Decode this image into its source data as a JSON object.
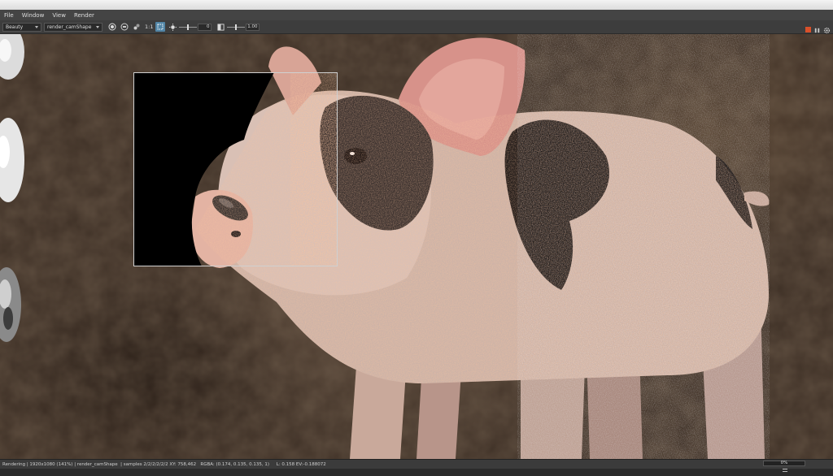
{
  "window": {
    "menu": [
      "File",
      "Window",
      "View",
      "Render"
    ]
  },
  "toolbar": {
    "aov_select": "Beauty",
    "camera_select": "render_camShape",
    "ratio_label": "1:1",
    "exposure_value": "0",
    "gamma_value": "1.00",
    "exposure_level": 0.5,
    "gamma_level": 0.5
  },
  "icons": {
    "snapshot": "snapshot-icon",
    "region": "region-icon",
    "display_settings": "display-settings-icon",
    "crop": "crop-region-icon",
    "exposure": "exposure-icon",
    "gamma": "gamma-icon",
    "stop": "stop-render-icon",
    "pause": "pause-icon",
    "settings": "gear-icon"
  },
  "colors": {
    "accent": "#5285a6",
    "stop": "#d9502a",
    "progress": "#5a8bb0"
  },
  "status": {
    "text": "Rendering | 1920x1080 (141%) | render_camShape  | samples 2/2/2/2/2/2 XY: 758,462   RGBA: (0.174, 0.135, 0.135, 1)     L: 0.158 EV:-0.188072",
    "progress_label": "0%",
    "progress_value": 0
  }
}
